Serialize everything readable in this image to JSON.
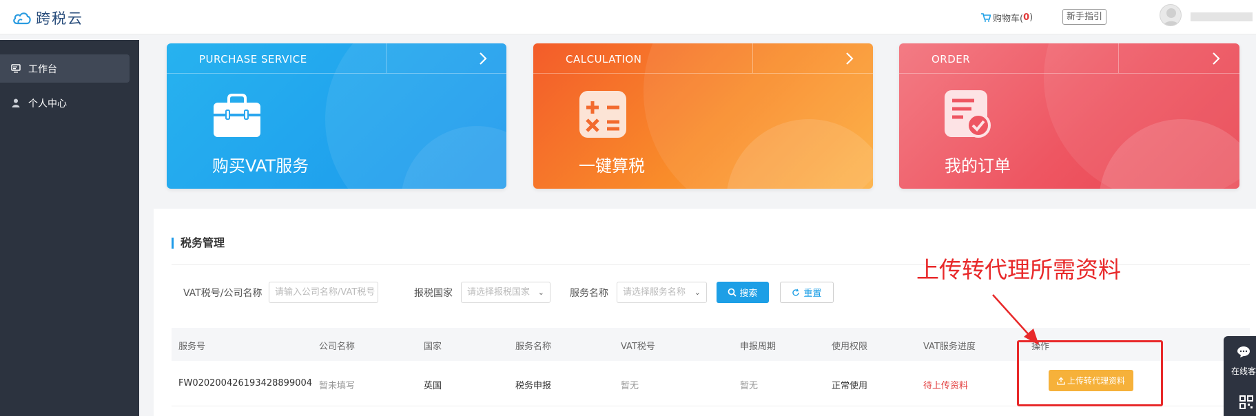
{
  "header": {
    "logo_text": "跨税云",
    "cart_label": "购物车(",
    "cart_count": "0",
    "cart_close": ")",
    "guide_label": "新手指引"
  },
  "sidebar": {
    "items": [
      {
        "label": "工作台",
        "icon": "monitor-icon",
        "active": true
      },
      {
        "label": "个人中心",
        "icon": "user-icon",
        "active": false
      }
    ]
  },
  "cards": [
    {
      "label_en": "PURCHASE SERVICE",
      "title": "购买VAT服务",
      "icon": "toolbox-icon",
      "color": "#1c98ec"
    },
    {
      "label_en": "CALCULATION",
      "title": "一键算税",
      "icon": "calculator-icon",
      "color": "#f98c2a"
    },
    {
      "label_en": "ORDER",
      "title": "我的订单",
      "icon": "order-check-icon",
      "color": "#ee5662"
    }
  ],
  "tax_section": {
    "title": "税务管理",
    "filters": {
      "vat_label": "VAT税号/公司名称",
      "vat_placeholder": "请输入公司名称/VAT税号",
      "country_label": "报税国家",
      "country_placeholder": "请选择报税国家",
      "service_label": "服务名称",
      "service_placeholder": "请选择服务名称",
      "search_button": "搜索",
      "reset_button": "重置"
    },
    "columns": [
      "服务号",
      "公司名称",
      "国家",
      "服务名称",
      "VAT税号",
      "申报周期",
      "使用权限",
      "VAT服务进度",
      "操作"
    ],
    "rows": [
      {
        "service_no": "FW020200426193428899004",
        "company": "暂未填写",
        "country": "英国",
        "service_name": "税务申报",
        "vat_no": "暂无",
        "period": "暂无",
        "permission": "正常使用",
        "progress": "待上传资料",
        "action": "上传转代理资料"
      }
    ]
  },
  "annotation": {
    "text": "上传转代理所需资料",
    "color": "#e8292a"
  },
  "float_widget": {
    "label": "在线客"
  }
}
